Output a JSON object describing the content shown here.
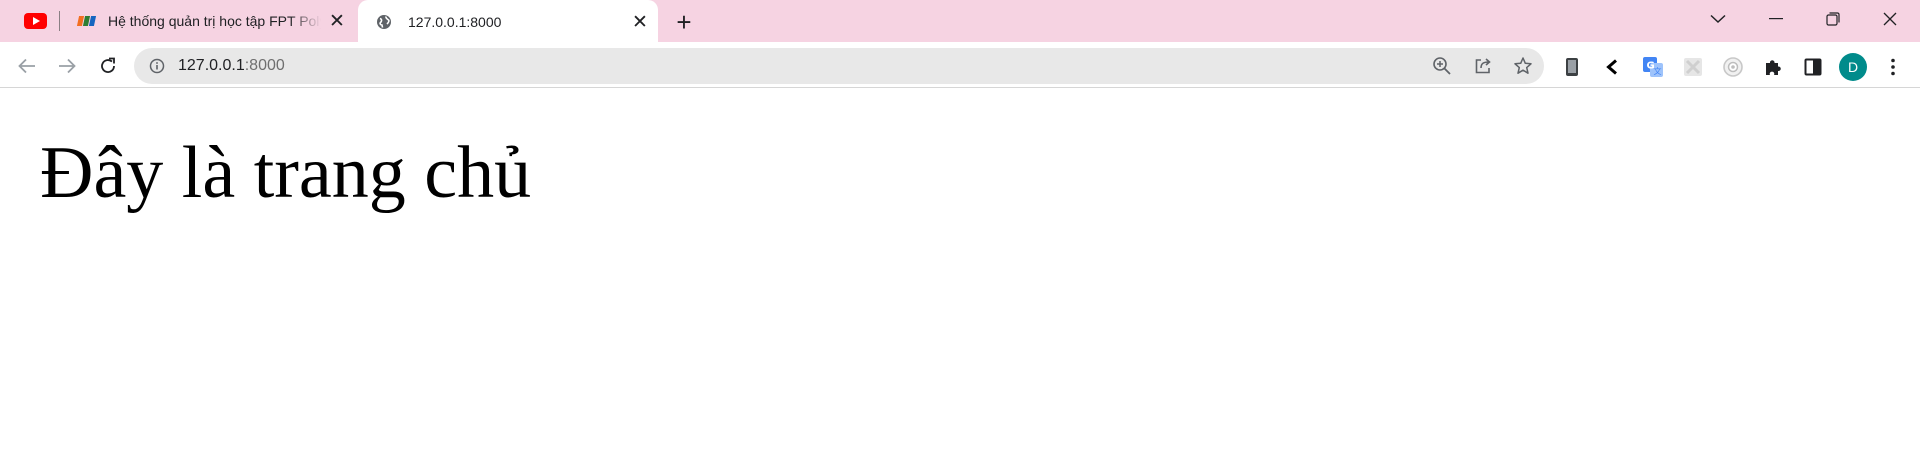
{
  "tabs": {
    "pinned": {
      "icon": "youtube-icon"
    },
    "items": [
      {
        "title": "Hệ thống quản trị học tập FPT Polytechnic",
        "icon": "fpt-logo-icon",
        "close": "✕",
        "active": false
      },
      {
        "title": "127.0.0.1:8000",
        "icon": "globe-icon",
        "close": "✕",
        "active": true
      }
    ],
    "new_tab_label": "+"
  },
  "window_controls": [
    "tab-search",
    "minimize",
    "restore",
    "close"
  ],
  "toolbar": {
    "url_host": "127.0.0.1",
    "url_port": ":8000",
    "omnibox_actions": [
      "zoom-icon",
      "share-icon",
      "star-icon"
    ],
    "extensions": [
      "phone-extension-icon",
      "back-arrow-extension-icon",
      "google-translate-icon",
      "blocked-extension-icon",
      "camera-extension-icon",
      "puzzle-icon",
      "side-panel-icon"
    ],
    "profile_initial": "D"
  },
  "colors": {
    "tabstrip": "#f6d3e2",
    "omnibox": "#e8e8e8",
    "avatar": "#008b8b",
    "youtube": "#ff0000"
  },
  "page": {
    "heading": "Đây là trang chủ"
  }
}
